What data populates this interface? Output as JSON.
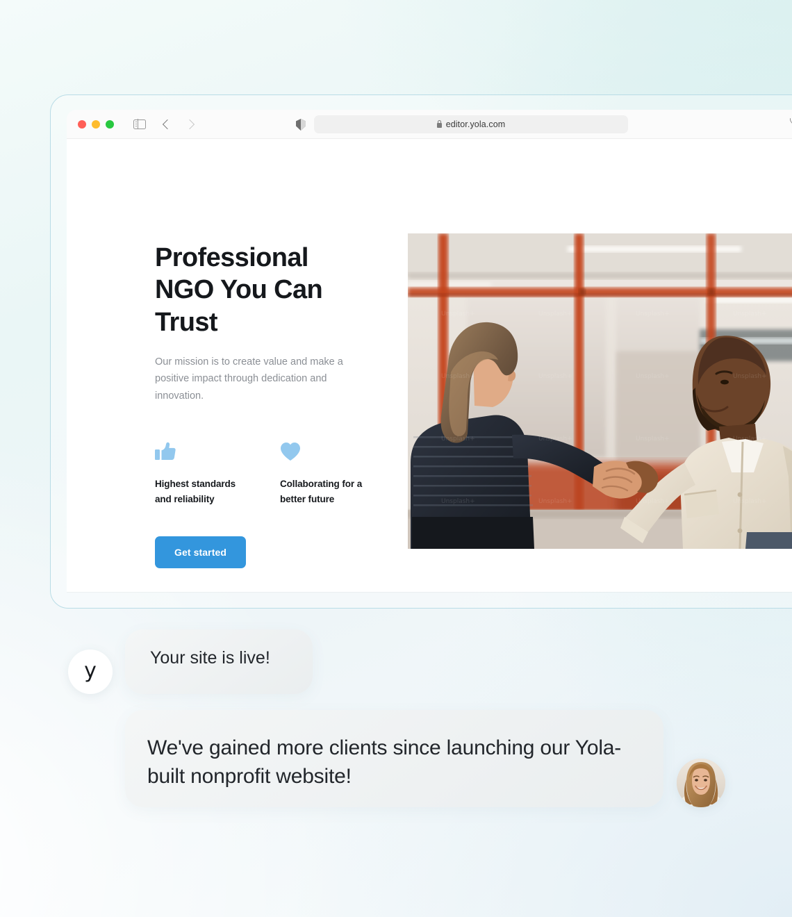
{
  "browser": {
    "traffic_lights": [
      "close",
      "minimize",
      "maximize"
    ],
    "url": "editor.yola.com",
    "lock_icon": "lock-icon",
    "reload_icon": "reload-icon",
    "sidebar_icon": "sidebar-toggle-icon",
    "back_icon": "chevron-left-icon",
    "forward_icon": "chevron-right-icon",
    "shield_icon": "shield-icon"
  },
  "site": {
    "hero": {
      "title": "Professional NGO You Can Trust",
      "subtitle": "Our mission is to create value and make a positive impact through dedication and innovation.",
      "cta_label": "Get started",
      "cta_color": "#3396dd",
      "features": [
        {
          "icon": "thumbs-up-icon",
          "label": "Highest standards and reliability",
          "icon_color": "#92c8ee"
        },
        {
          "icon": "heart-icon",
          "label": "Collaborating for a better future",
          "icon_color": "#92c8ee"
        }
      ],
      "image_alt": "Two colleagues shaking hands in an office with orange glass partitions"
    }
  },
  "chat": {
    "logo_letter": "y",
    "messages": [
      {
        "text": "Your site is live!",
        "sender": "yola"
      },
      {
        "text": "We've gained more clients since launching our Yola-built nonprofit website!",
        "sender": "customer"
      }
    ],
    "customer_avatar_alt": "Smiling woman with long wavy hair"
  }
}
